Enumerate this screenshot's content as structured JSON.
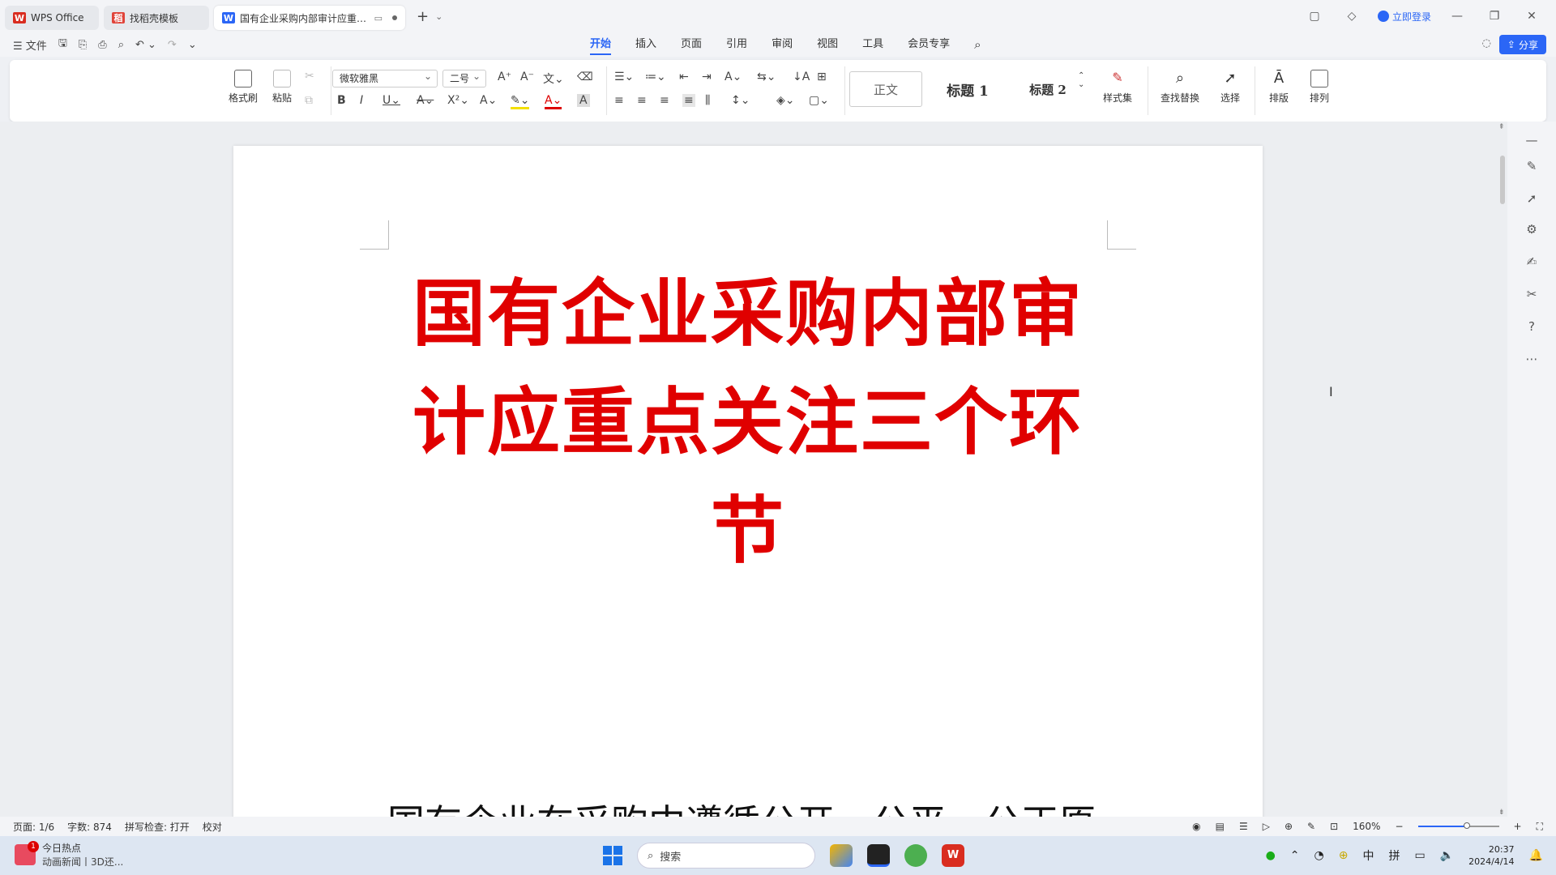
{
  "window": {
    "tabs": [
      {
        "label": "WPS Office",
        "logo": "W",
        "color": "#d92d20"
      },
      {
        "label": "找稻壳模板",
        "logo": "稻",
        "color": "#e0443a"
      },
      {
        "label": "国有企业采购内部审计应重点关注三个环节",
        "logo": "W",
        "color": "#2b66f6"
      }
    ],
    "login": "立即登录"
  },
  "menu": {
    "file": "文件",
    "tabs": [
      "开始",
      "插入",
      "页面",
      "引用",
      "审阅",
      "视图",
      "工具",
      "会员专享"
    ],
    "active_tab": "开始",
    "share": "分享"
  },
  "ribbon": {
    "format_painter": "格式刷",
    "paste": "粘贴",
    "font_name": "微软雅黑",
    "font_size": "二号",
    "styles": [
      "正文",
      "标题 1",
      "标题 2"
    ],
    "style_set": "样式集",
    "find_replace": "查找替换",
    "select": "选择",
    "layout": "排版",
    "arrange": "排列"
  },
  "document": {
    "title_lines": [
      "国有企业采购内部审",
      "计应重点关注三个环",
      "节"
    ],
    "body_first_line": "国有企业在采购中遵循公开、公平、公正原",
    "title_color": "#e00000"
  },
  "status": {
    "page": "页面: 1/6",
    "word_count": "字数: 874",
    "spell_check": "拼写检查: 打开",
    "proof": "校对",
    "zoom": "160%",
    "zoom_level": 0.6
  },
  "taskbar": {
    "news_title": "今日热点",
    "news_sub": "动画新闻丨3D还...",
    "news_badge": "1",
    "search_placeholder": "搜索",
    "tray_lang": "中",
    "tray_ime": "拼",
    "time": "20:37",
    "date": "2024/4/14"
  }
}
